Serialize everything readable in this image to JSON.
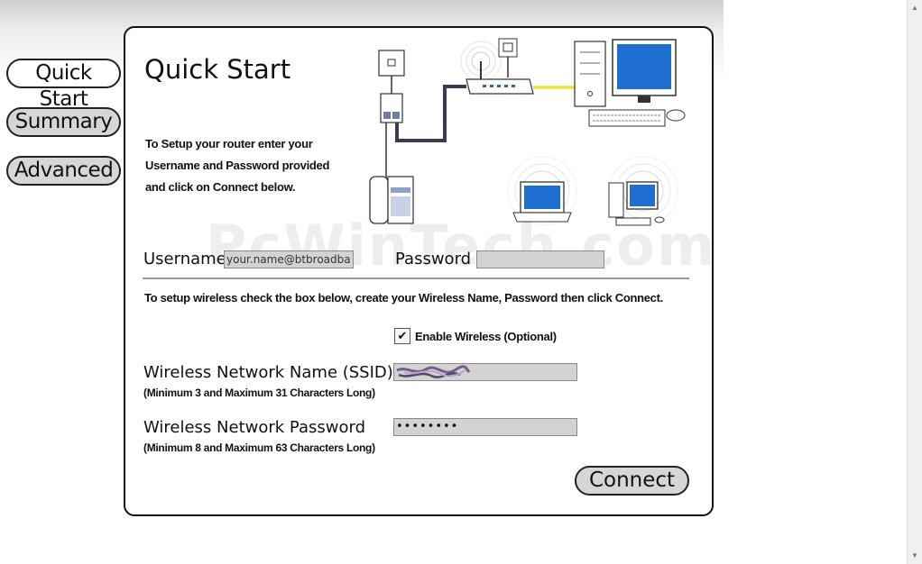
{
  "nav": {
    "quick_start": "Quick Start",
    "summary": "Summary",
    "advanced": "Advanced"
  },
  "main": {
    "title": "Quick Start",
    "intro_lines": [
      "To Setup your router enter your",
      "Username and Password provided",
      "and click on Connect below."
    ],
    "watermark": "PcWinTech.com"
  },
  "credentials": {
    "username_label": "Username",
    "username_value": "your.name@btbroadba",
    "password_label": "Password",
    "password_value": ""
  },
  "wireless": {
    "note": "To setup wireless check the box below, create your Wireless Name, Password then click Connect.",
    "enable_label": "Enable Wireless (Optional)",
    "enable_checked": true,
    "ssid_label": "Wireless Network Name (SSID)",
    "ssid_hint": "(Minimum 3 and Maximum 31 Characters Long)",
    "password_label": "Wireless Network Password",
    "password_value": "••••••••",
    "password_hint": "(Minimum 8 and Maximum 63 Characters Long)"
  },
  "actions": {
    "connect": "Connect"
  },
  "colors": {
    "cable_dark": "#3a3a55",
    "cable_yellow": "#f2e23a",
    "screen_blue": "#1e6fd0"
  },
  "icons": [
    "router-icon",
    "phone-icon",
    "desktop-computer-icon",
    "laptop-icon",
    "wifi-signal-icon"
  ]
}
